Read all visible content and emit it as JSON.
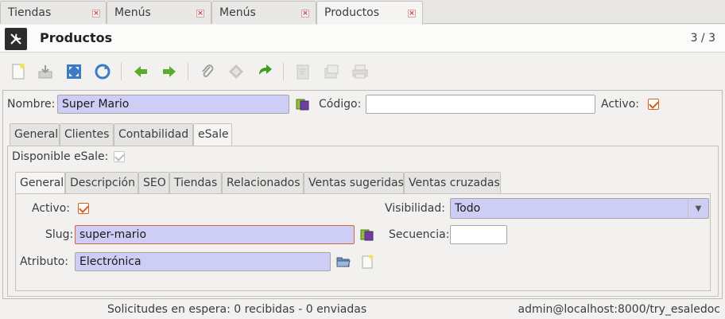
{
  "top_tabs": [
    {
      "label": "Tiendas",
      "active": false
    },
    {
      "label": "Menús",
      "active": false
    },
    {
      "label": "Menús",
      "active": false
    },
    {
      "label": "Productos",
      "active": true
    }
  ],
  "title_bar": {
    "title": "Productos",
    "counter": "3 / 3",
    "icon": "tools-icon"
  },
  "toolbar": {
    "buttons": [
      "new-record-icon",
      "save-icon",
      "switch-view-icon",
      "reload-icon",
      "previous-icon",
      "next-icon",
      "attachment-icon",
      "action-icon",
      "relate-icon",
      "report-icon",
      "email-icon",
      "print-icon"
    ]
  },
  "header_form": {
    "nombre_label": "Nombre:",
    "nombre_value": "Super Mario",
    "codigo_label": "Código:",
    "codigo_value": "",
    "activo_label": "Activo:",
    "activo_checked": true
  },
  "main_tabs": [
    "General",
    "Clientes",
    "Contabilidad",
    "eSale"
  ],
  "main_active_tab": "eSale",
  "esale": {
    "disponible_label": "Disponible eSale:",
    "disponible_checked": true,
    "sub_tabs": [
      "General",
      "Descripción",
      "SEO",
      "Tiendas",
      "Relacionados",
      "Ventas sugeridas",
      "Ventas cruzadas"
    ],
    "sub_active_tab": "General",
    "general": {
      "activo_label": "Activo:",
      "activo_checked": true,
      "visibilidad_label": "Visibilidad:",
      "visibilidad_value": "Todo",
      "slug_label": "Slug:",
      "slug_value": "super-mario",
      "secuencia_label": "Secuencia:",
      "secuencia_value": "",
      "atributo_label": "Atributo:",
      "atributo_value": "Electrónica"
    }
  },
  "status_bar": {
    "requests": "Solicitudes en espera: 0 recibidas - 0 enviadas",
    "connection": "admin@localhost:8000/try_esaledoc"
  },
  "colors": {
    "required_field": "#cecdf6",
    "check_accent": "#d4601e",
    "close_red": "#d23a3a"
  }
}
